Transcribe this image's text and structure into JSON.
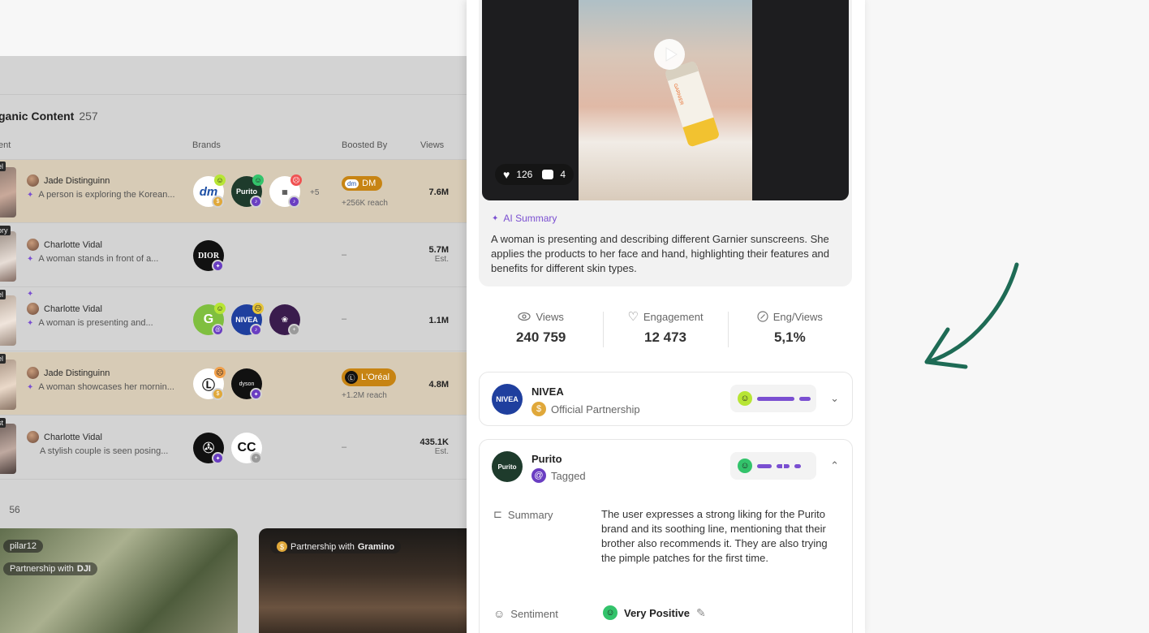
{
  "background": {
    "section_title": "ganic Content",
    "section_count": "257",
    "columns": {
      "content": "ent",
      "brands": "Brands",
      "boosted_by": "Boosted By",
      "views": "Views"
    },
    "rows": [
      {
        "thumb_tag": "el",
        "creator": "Jade Distinguinn",
        "description": "A person is exploring the Korean...",
        "extra_brands": "+5",
        "boost_label": "DM",
        "boost_reach": "+256K reach",
        "views": "7.6M",
        "views_note": ""
      },
      {
        "thumb_tag": "ory",
        "creator": "Charlotte Vidal",
        "description": "A woman stands in front of a...",
        "boost_label": "–",
        "views": "5.7M",
        "views_note": "Est."
      },
      {
        "thumb_tag": "el",
        "creator": "Charlotte Vidal",
        "description": "A woman is presenting and...",
        "boost_label": "–",
        "views": "1.1M",
        "views_note": ""
      },
      {
        "thumb_tag": "el",
        "creator": "Jade Distinguinn",
        "description": "A woman showcases her mornin...",
        "boost_label": "L'Oréal",
        "boost_reach": "+1.2M reach",
        "views": "4.8M",
        "views_note": ""
      },
      {
        "thumb_tag": "st",
        "creator": "Charlotte Vidal",
        "description": "A stylish couple is seen posing...",
        "boost_label": "–",
        "views": "435.1K",
        "views_note": "Est."
      }
    ],
    "second_section_count": "56",
    "cards": [
      {
        "creator": "pilar12",
        "partnership": "Partnership with",
        "partner": "DJI"
      },
      {
        "partnership": "Partnership with",
        "partner": "Gramino"
      }
    ],
    "brand_logos": {
      "dm": "dm",
      "purito": "Purito",
      "dior": "DIOR",
      "nivea": "NIVEA",
      "dyson": "dyson"
    }
  },
  "panel": {
    "video": {
      "likes": "126",
      "comments": "4",
      "product_text": "GARNIER"
    },
    "ai_summary": {
      "label": "AI Summary",
      "text": "A woman is presenting and describing different Garnier sunscreens. She applies the products to her face and hand, highlighting their features and benefits for different skin types."
    },
    "metrics": [
      {
        "label": "Views",
        "value": "240 759",
        "icon": "eye-icon"
      },
      {
        "label": "Engagement",
        "value": "12 473",
        "icon": "heart-icon"
      },
      {
        "label": "Eng/Views",
        "value": "5,1%",
        "icon": "percent-icon"
      }
    ],
    "brands": [
      {
        "name": "NIVEA",
        "type": "Official Partnership",
        "logo_text": "NIVEA",
        "logo_color": "#1f3f9e",
        "type_icon_color": "#e0a83a",
        "expanded": false
      },
      {
        "name": "Purito",
        "type": "Tagged",
        "logo_text": "Purito",
        "logo_color": "#1e3b2c",
        "type_icon_color": "#6a3ec2",
        "expanded": true,
        "summary_label": "Summary",
        "summary": "The user expresses a strong liking for the Purito brand and its soothing line, mentioning that their brother also recommends it. They are also trying the pimple patches for the first time.",
        "sentiment_label": "Sentiment",
        "sentiment": "Very Positive"
      }
    ]
  },
  "colors": {
    "accent": "#7a4fd1",
    "arrow": "#1e6b55"
  }
}
